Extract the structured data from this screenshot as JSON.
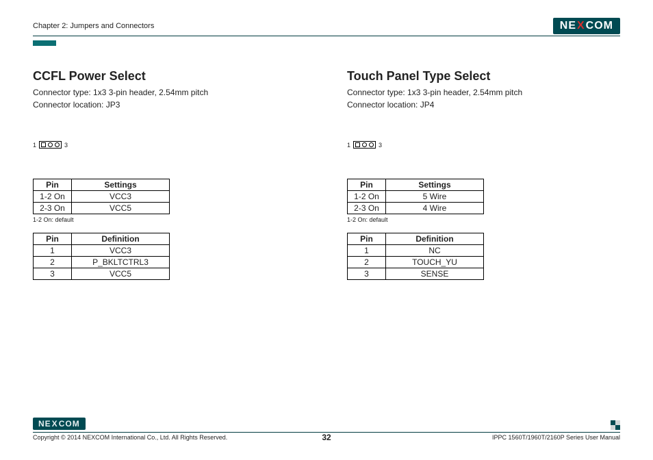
{
  "header": {
    "chapter": "Chapter 2: Jumpers and Connectors",
    "brand": "NEXCOM"
  },
  "left": {
    "title": "CCFL Power Select",
    "conn_type": "Connector type: 1x3 3-pin header, 2.54mm pitch",
    "conn_loc": "Connector location: JP3",
    "diag_left": "1",
    "diag_right": "3",
    "settings": {
      "h1": "Pin",
      "h2": "Settings",
      "rows": [
        {
          "pin": "1-2 On",
          "val": "VCC3"
        },
        {
          "pin": "2-3 On",
          "val": "VCC5"
        }
      ],
      "note": "1-2 On: default"
    },
    "definition": {
      "h1": "Pin",
      "h2": "Definition",
      "rows": [
        {
          "pin": "1",
          "val": "VCC3"
        },
        {
          "pin": "2",
          "val": "P_BKLTCTRL3"
        },
        {
          "pin": "3",
          "val": "VCC5"
        }
      ]
    }
  },
  "right": {
    "title": "Touch Panel Type Select",
    "conn_type": "Connector type: 1x3 3-pin header, 2.54mm pitch",
    "conn_loc": "Connector location: JP4",
    "diag_left": "1",
    "diag_right": "3",
    "settings": {
      "h1": "Pin",
      "h2": "Settings",
      "rows": [
        {
          "pin": "1-2 On",
          "val": "5 Wire"
        },
        {
          "pin": "2-3 On",
          "val": "4 Wire"
        }
      ],
      "note": "1-2 On: default"
    },
    "definition": {
      "h1": "Pin",
      "h2": "Definition",
      "rows": [
        {
          "pin": "1",
          "val": "NC"
        },
        {
          "pin": "2",
          "val": "TOUCH_YU"
        },
        {
          "pin": "3",
          "val": "SENSE"
        }
      ]
    }
  },
  "footer": {
    "copyright": "Copyright © 2014 NEXCOM International Co., Ltd. All Rights Reserved.",
    "page": "32",
    "manual": "IPPC 1560T/1960T/2160P Series User Manual"
  }
}
